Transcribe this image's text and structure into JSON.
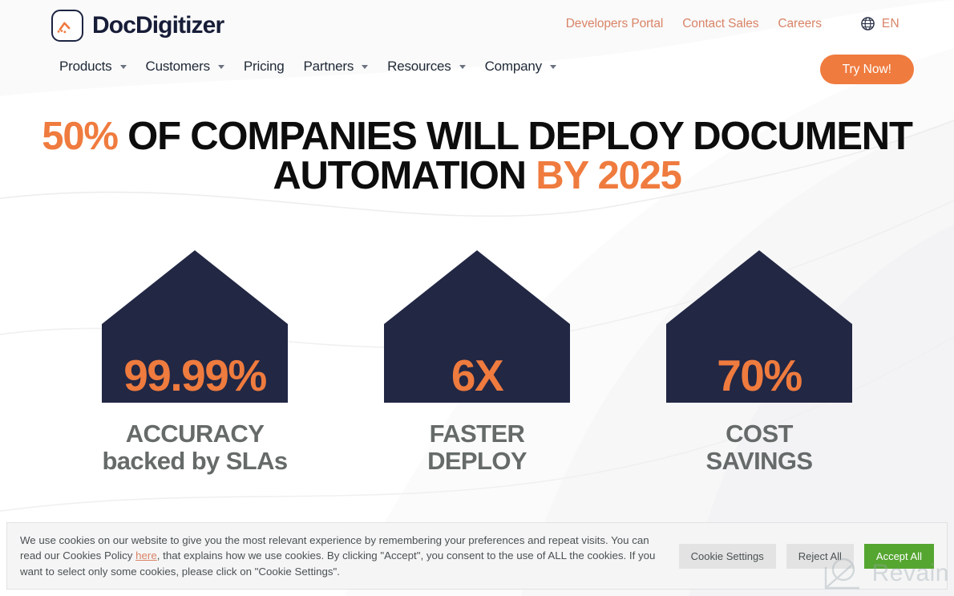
{
  "brand": {
    "name": "DocDigitizer",
    "logo_icon": "docdigitizer-logo-icon",
    "accent_orange": "#ef7b3e",
    "navy": "#222744",
    "salmon": "#d98467",
    "gray_label": "#666b6a",
    "green": "#55a630"
  },
  "header": {
    "top_links": [
      {
        "label": "Developers Portal"
      },
      {
        "label": "Contact Sales"
      },
      {
        "label": "Careers"
      }
    ],
    "language": {
      "icon": "globe-icon",
      "label": "EN"
    },
    "nav_items": [
      {
        "label": "Products",
        "has_dropdown": true
      },
      {
        "label": "Customers",
        "has_dropdown": true
      },
      {
        "label": "Pricing",
        "has_dropdown": false
      },
      {
        "label": "Partners",
        "has_dropdown": true
      },
      {
        "label": "Resources",
        "has_dropdown": true
      },
      {
        "label": "Company",
        "has_dropdown": true
      }
    ],
    "cta_label": "Try Now!"
  },
  "hero": {
    "line1_highlight": "50%",
    "line1_rest": " OF COMPANIES WILL DEPLOY DOCUMENT",
    "line2_rest": "AUTOMATION ",
    "line2_highlight": "BY 2025"
  },
  "stats": [
    {
      "value": "99.99%",
      "label_line1": "ACCURACY",
      "label_line2": "backed by SLAs"
    },
    {
      "value": "6X",
      "label_line1": "FASTER",
      "label_line2": "DEPLOY"
    },
    {
      "value": "70%",
      "label_line1": "COST",
      "label_line2": "SAVINGS"
    }
  ],
  "cookie_banner": {
    "text_part1": "We use cookies on our website to give you the most relevant experience by remembering your preferences and repeat visits. You can read our Cookies Policy ",
    "link_label": "here",
    "text_part2": ", that explains how we use cookies. By clicking \"Accept\", you consent to the use of ALL the cookies. If you want to select only some cookies, please click on \"Cookie Settings\".",
    "buttons": [
      {
        "label": "Cookie Settings",
        "style": "secondary"
      },
      {
        "label": "Reject All",
        "style": "secondary"
      },
      {
        "label": "Accept All",
        "style": "accept"
      }
    ]
  },
  "watermark": {
    "label": "Revain",
    "icon": "revain-camera-icon"
  }
}
